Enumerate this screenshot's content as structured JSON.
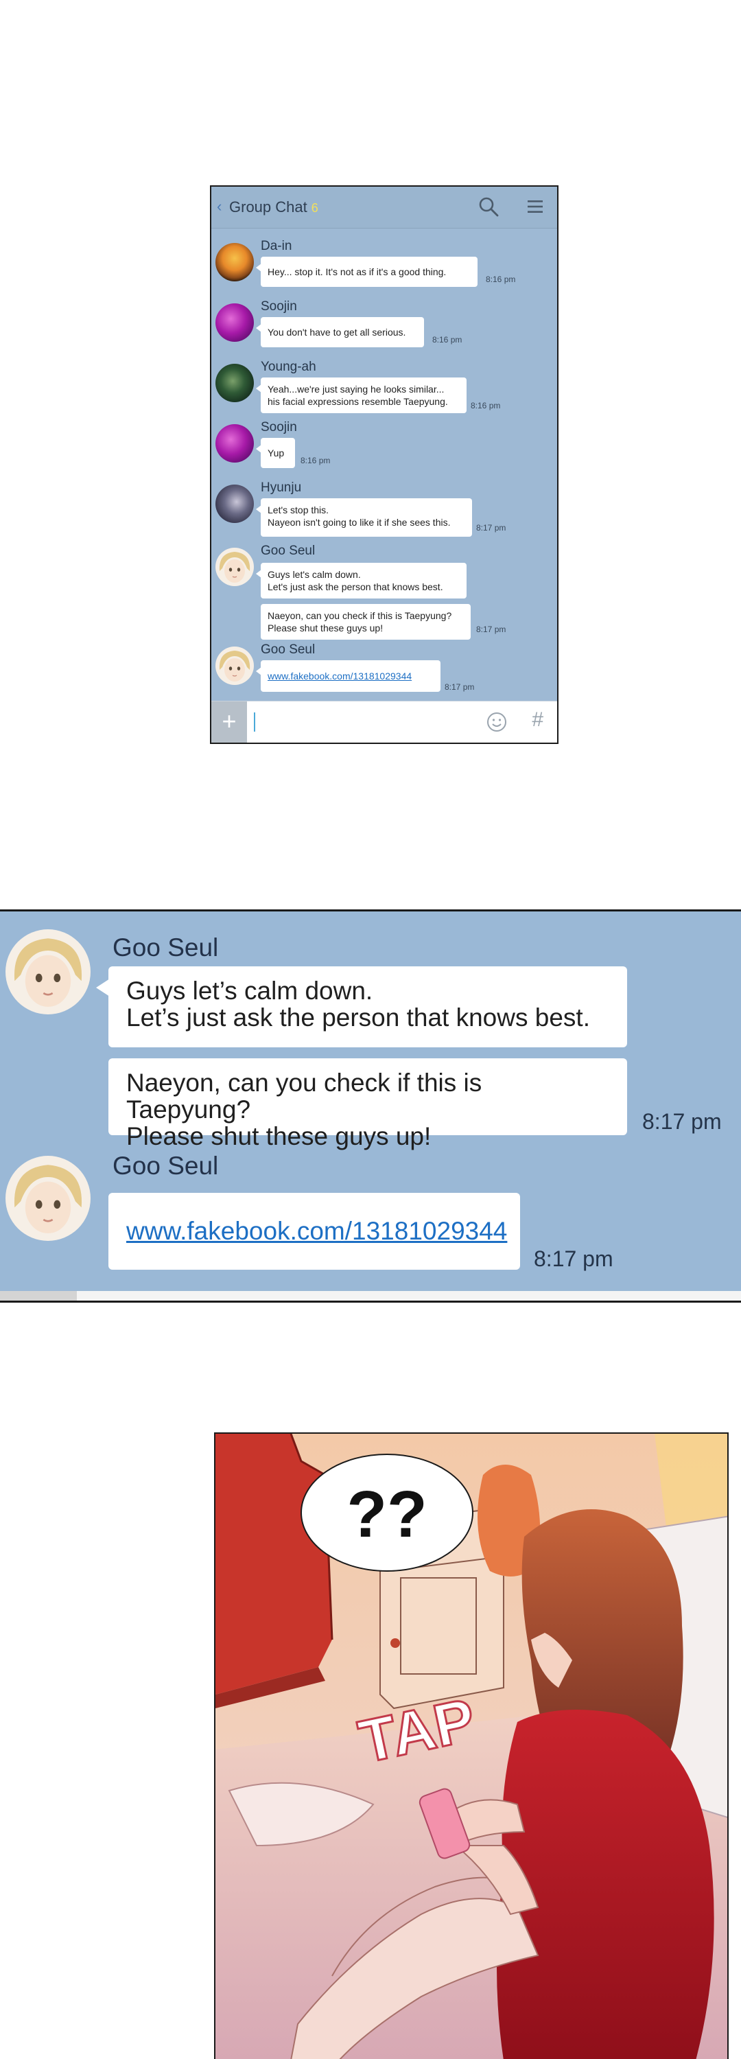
{
  "group_chat": {
    "title": "Group Chat",
    "member_count": "6",
    "messages": [
      {
        "sender": "Da-in",
        "text": "Hey... stop it. It's not as if it's a good thing.",
        "time": "8:16 pm"
      },
      {
        "sender": "Soojin",
        "text": "You don't have to get all serious.",
        "time": "8:16 pm"
      },
      {
        "sender": "Young-ah",
        "text": "Yeah...we're just saying he looks similar...\nhis facial expressions resemble Taepyung.",
        "time": "8:16 pm"
      },
      {
        "sender": "Soojin",
        "text": "Yup",
        "time": "8:16 pm"
      },
      {
        "sender": "Hyunju",
        "text": "Let's stop this.\nNayeon isn't going to like it if she sees this.",
        "time": "8:17 pm"
      },
      {
        "sender": "Goo Seul",
        "text": "Guys let's calm down.\nLet's just ask the person that knows best.",
        "text2": "Naeyon, can you check if this is Taepyung?\nPlease shut these guys up!",
        "time": "8:17 pm"
      },
      {
        "sender": "Goo Seul",
        "link": "www.fakebook.com/13181029344",
        "time": "8:17 pm"
      }
    ],
    "icons": {
      "back": "chevron-left-icon",
      "search": "search-icon",
      "menu": "hamburger-menu-icon",
      "add": "plus-icon",
      "emoji": "smiley-icon",
      "hashtag": "hashtag-icon"
    }
  },
  "zoom": {
    "msg1": {
      "sender": "Goo Seul",
      "text1": "Guys let’s calm down.\nLet’s just ask the person that knows best.",
      "text2": "Naeyon, can you check if this is Taepyung?\nPlease shut these guys up!",
      "time": "8:17 pm"
    },
    "msg2": {
      "sender": "Goo Seul",
      "link": "www.fakebook.com/13181029344",
      "time": "8:17 pm"
    }
  },
  "scene": {
    "speech": "??",
    "sfx": "TAP"
  },
  "colors": {
    "chat_bg": "#9eb9d4",
    "link": "#1d6fc4",
    "count": "#f3e05a"
  }
}
